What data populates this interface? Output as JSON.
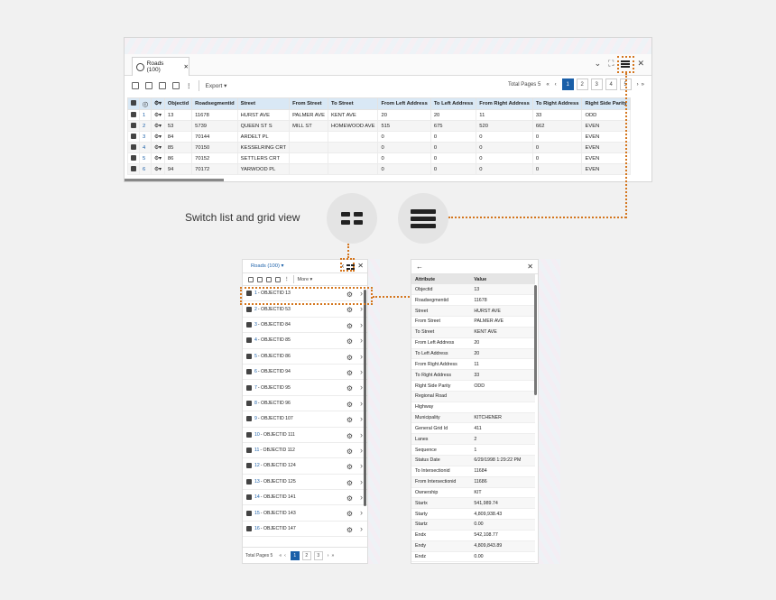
{
  "top": {
    "tab_label": "Roads (100)",
    "toolbar": {
      "export_label": "Export ▾"
    },
    "pager": {
      "total_label": "Total Pages 5",
      "pages": [
        "1",
        "2",
        "3",
        "4",
        "5"
      ]
    },
    "columns": [
      "Objectid",
      "Roadsegmentid",
      "Street",
      "From Street",
      "To Street",
      "From Left Address",
      "To Left Address",
      "From Right Address",
      "To Right Address",
      "Right Side Parity"
    ],
    "rows": [
      [
        "1",
        "13",
        "11678",
        "HURST AVE",
        "PALMER AVE",
        "KENT AVE",
        "20",
        "20",
        "11",
        "33",
        "ODD"
      ],
      [
        "2",
        "53",
        "5739",
        "QUEEN ST S",
        "MILL ST",
        "HOMEWOOD AVE",
        "515",
        "675",
        "520",
        "662",
        "EVEN"
      ],
      [
        "3",
        "84",
        "70144",
        "ARDELT PL",
        "",
        "",
        "0",
        "0",
        "0",
        "0",
        "EVEN"
      ],
      [
        "4",
        "85",
        "70150",
        "KESSELRING CRT",
        "",
        "",
        "0",
        "0",
        "0",
        "0",
        "EVEN"
      ],
      [
        "5",
        "86",
        "70152",
        "SETTLERS CRT",
        "",
        "",
        "0",
        "0",
        "0",
        "0",
        "EVEN"
      ],
      [
        "6",
        "94",
        "70172",
        "YARWOOD PL",
        "",
        "",
        "0",
        "0",
        "0",
        "0",
        "EVEN"
      ]
    ]
  },
  "switch_label": "Switch list and grid view",
  "list": {
    "title": "Roads (100) ▾",
    "more_label": "More ▾",
    "items": [
      {
        "n": "1",
        "label": " - OBJECTID 13"
      },
      {
        "n": "2",
        "label": " - OBJECTID 53"
      },
      {
        "n": "3",
        "label": " - OBJECTID 84"
      },
      {
        "n": "4",
        "label": " - OBJECTID 85"
      },
      {
        "n": "5",
        "label": " - OBJECTID 86"
      },
      {
        "n": "6",
        "label": " - OBJECTID 94"
      },
      {
        "n": "7",
        "label": " - OBJECTID 95"
      },
      {
        "n": "8",
        "label": " - OBJECTID 96"
      },
      {
        "n": "9",
        "label": " - OBJECTID 107"
      },
      {
        "n": "10",
        "label": " - OBJECTID 111"
      },
      {
        "n": "11",
        "label": " - OBJECTID 112"
      },
      {
        "n": "12",
        "label": " - OBJECTID 124"
      },
      {
        "n": "13",
        "label": " - OBJECTID 125"
      },
      {
        "n": "14",
        "label": " - OBJECTID 141"
      },
      {
        "n": "15",
        "label": " - OBJECTID 143"
      },
      {
        "n": "16",
        "label": " - OBJECTID 147"
      }
    ],
    "footer": {
      "total_label": "Total Pages 5",
      "pages": [
        "1",
        "2",
        "3"
      ]
    }
  },
  "detail": {
    "header_attr": "Attribute",
    "header_value": "Value",
    "rows": [
      [
        "Objectid",
        "13"
      ],
      [
        "Roadsegmentid",
        "11678"
      ],
      [
        "Street",
        "HURST AVE"
      ],
      [
        "From Street",
        "PALMER AVE"
      ],
      [
        "To Street",
        "KENT AVE"
      ],
      [
        "From Left Address",
        "20"
      ],
      [
        "To Left Address",
        "20"
      ],
      [
        "From Right Address",
        "11"
      ],
      [
        "To Right Address",
        "33"
      ],
      [
        "Right Side Parity",
        "ODD"
      ],
      [
        "Regional Road",
        ""
      ],
      [
        "Highway",
        ""
      ],
      [
        "Municipality",
        "KITCHENER"
      ],
      [
        "General Grid Id",
        "411"
      ],
      [
        "Lanes",
        "2"
      ],
      [
        "Sequence",
        "1"
      ],
      [
        "Status Date",
        "6/29/1998 1:29:22 PM"
      ],
      [
        "To Intersectionid",
        "11684"
      ],
      [
        "From Intersectionid",
        "11686"
      ],
      [
        "Ownership",
        "KIT"
      ],
      [
        "Startx",
        "541,989.74"
      ],
      [
        "Starty",
        "4,809,938.43"
      ],
      [
        "Startz",
        "0.00"
      ],
      [
        "Endx",
        "542,108.77"
      ],
      [
        "Endy",
        "4,809,843.89"
      ],
      [
        "Endz",
        "0.00"
      ]
    ]
  },
  "colors": {
    "accent": "#1a5fa8",
    "highlight": "#d4761e",
    "header_bg": "#d9e8f5"
  }
}
